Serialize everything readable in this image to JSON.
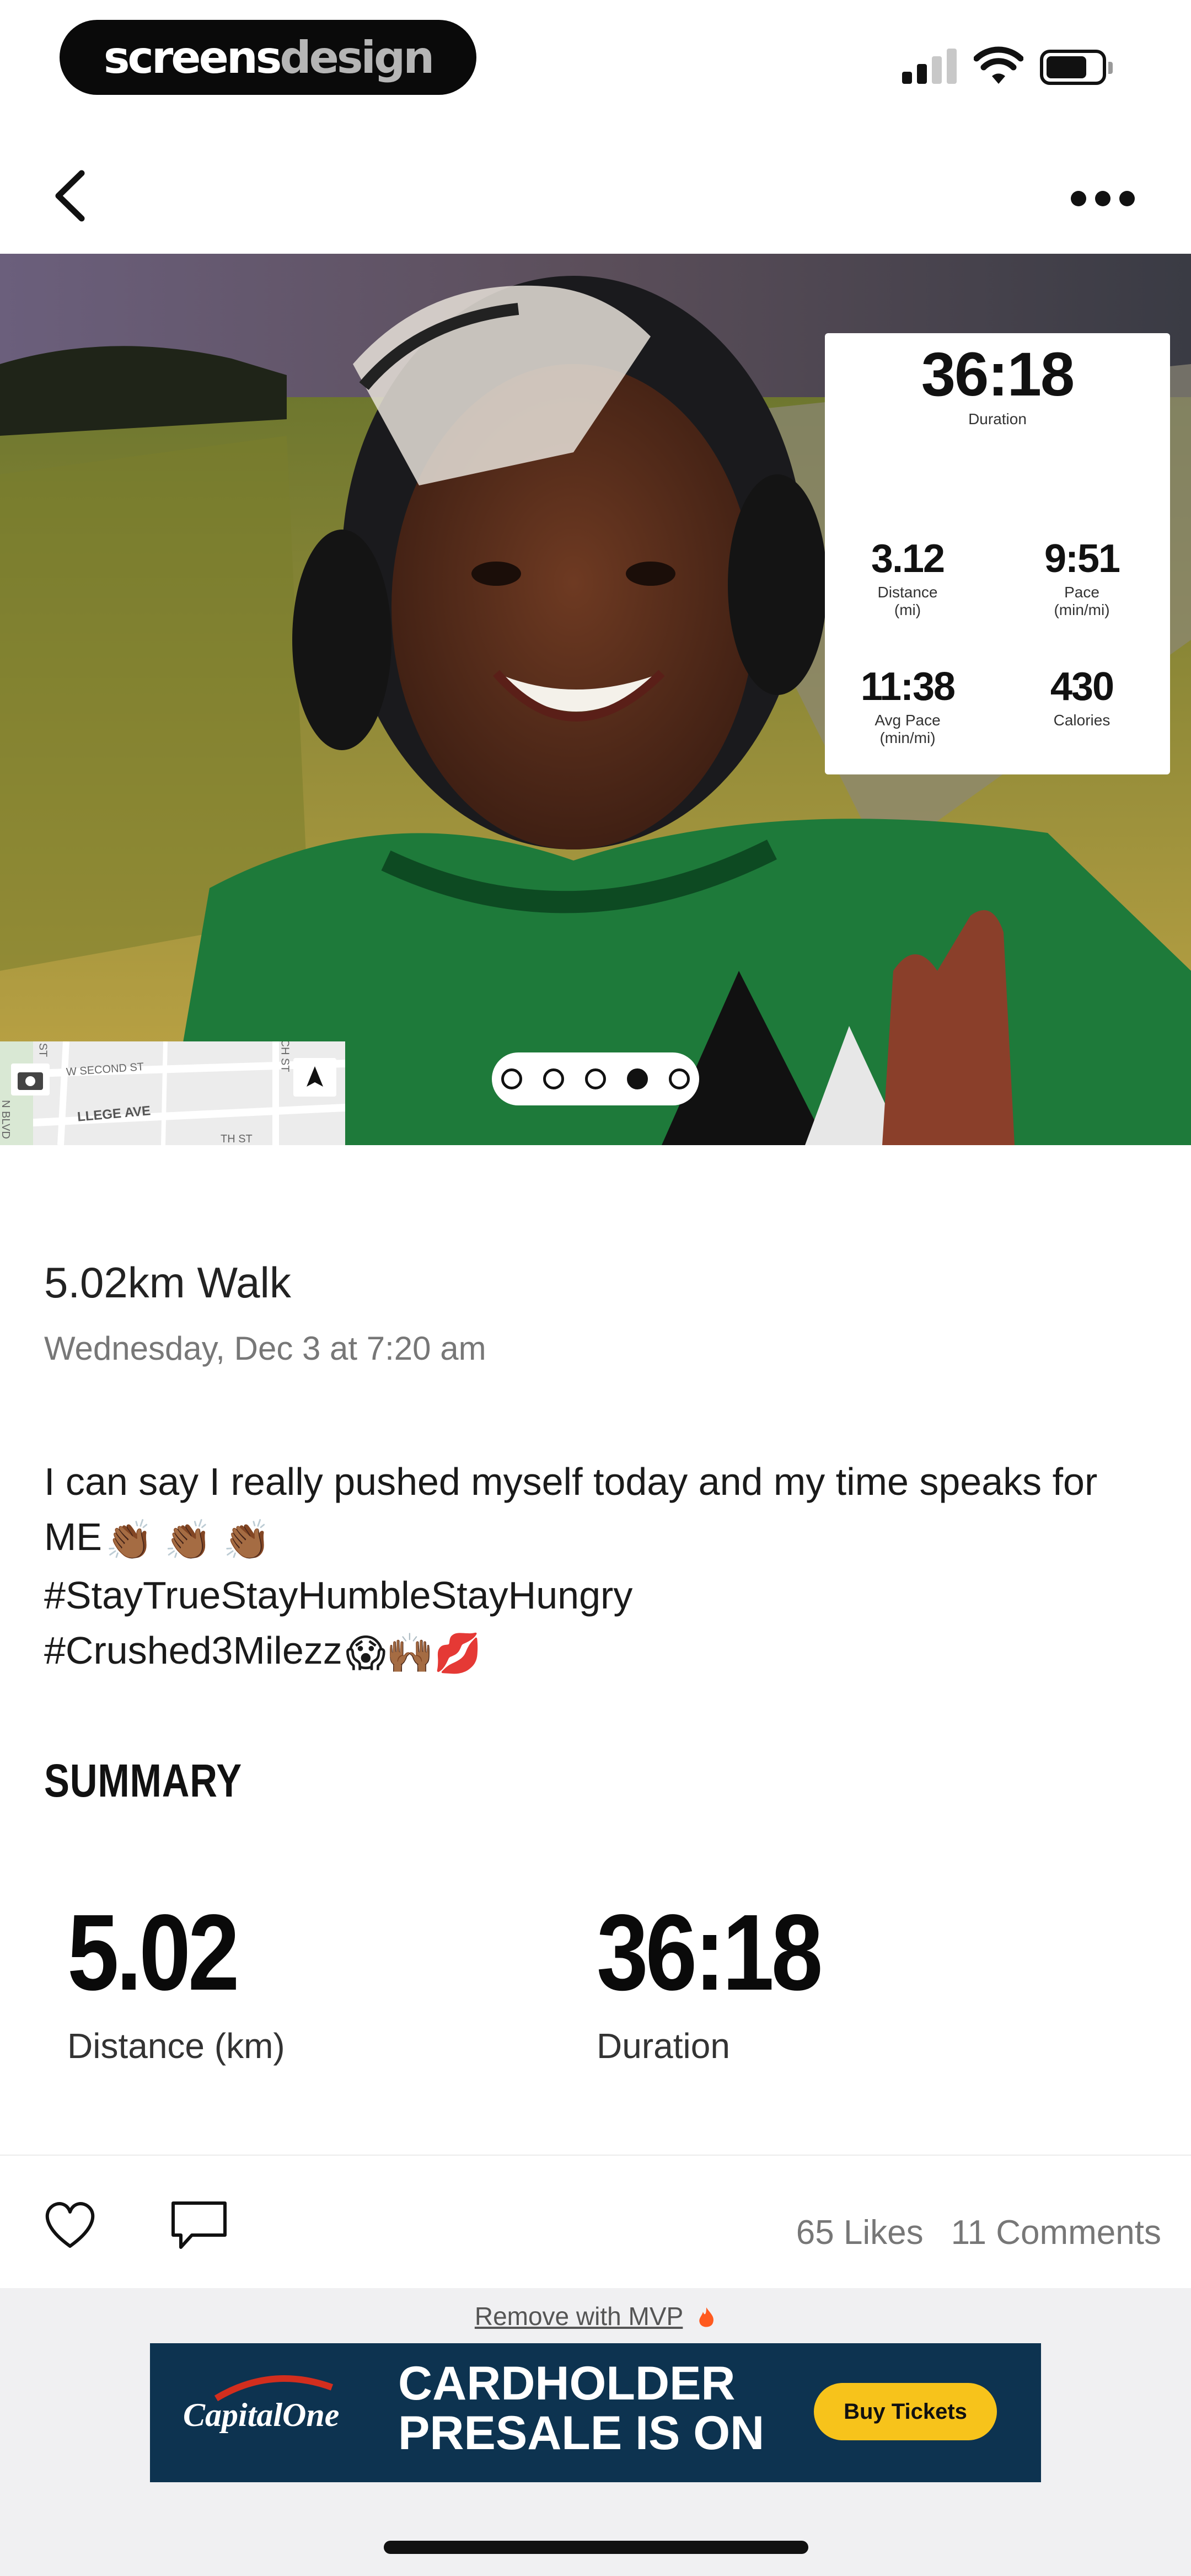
{
  "status_bar": {
    "brand_part1": "screens",
    "brand_part2": "design",
    "battery_level": 0.75,
    "signal_bars_active": 2,
    "signal_bars_total": 4
  },
  "nav": {
    "back_icon": "chevron-left-icon",
    "more_icon": "more-horizontal-icon"
  },
  "photo_stats": {
    "duration_value": "36:18",
    "duration_label": "Duration",
    "distance_value": "3.12",
    "distance_label": "Distance",
    "distance_unit": "(mi)",
    "pace_value": "9:51",
    "pace_label": "Pace",
    "pace_unit": "(min/mi)",
    "avg_pace_value": "11:38",
    "avg_pace_label": "Avg Pace",
    "avg_pace_unit": "(min/mi)",
    "calories_value": "430",
    "calories_label": "Calories"
  },
  "map_labels": {
    "street1": "W SECOND ST",
    "street2": "LLEGE AVE",
    "street3": "N BLVD",
    "street4": "CH ST",
    "street5": "ST",
    "street6": "TH ST"
  },
  "pager": {
    "total": 5,
    "active_index": 3
  },
  "post": {
    "title": "5.02km Walk",
    "date": "Wednesday, Dec 3 at 7:20 am",
    "text_line1": "I can say I really pushed myself today and my time speaks for ME",
    "text_line1_emoji": "👏🏾 👏🏾 👏🏾",
    "hashtag1": "#StayTrueStayHumbleStayHungry",
    "hashtag2": "#Crushed3Milezz",
    "hashtag2_emoji": "😱🙌🏾💋"
  },
  "summary": {
    "heading": "SUMMARY",
    "distance_value": "5.02",
    "distance_label": "Distance (km)",
    "duration_value": "36:18",
    "duration_label": "Duration"
  },
  "actions": {
    "like_icon": "heart-icon",
    "comment_icon": "comment-icon",
    "likes": "65 Likes",
    "comments": "11 Comments"
  },
  "ad": {
    "remove_link": "Remove with MVP",
    "brand": "CapitalOne",
    "headline": "CARDHOLDER PRESALE IS ON",
    "cta": "Buy Tickets"
  },
  "colors": {
    "accent_orange": "#ff5a1f",
    "ad_navy": "#0d3350",
    "ad_yellow": "#f7c31b",
    "shirt_green": "#1e7a3a"
  }
}
